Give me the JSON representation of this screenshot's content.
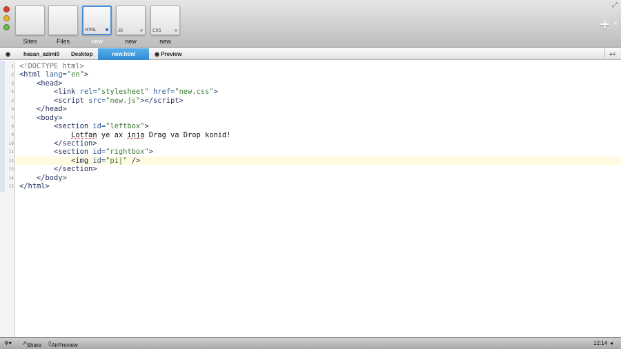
{
  "toolbar": {
    "tiles": [
      {
        "name": "Sites"
      },
      {
        "name": "Files"
      },
      {
        "name": "new",
        "badge": "HTML",
        "selected": true
      },
      {
        "name": "new",
        "badge": "JS"
      },
      {
        "name": "new",
        "badge": "CSS"
      }
    ],
    "add_label": "+"
  },
  "breadcrumb": {
    "items": [
      "hasan_azimi0",
      "Desktop",
      "new.html"
    ],
    "preview": "Preview"
  },
  "editor": {
    "line_numbers": [
      "1",
      "2",
      "3",
      "4",
      "5",
      "6",
      "7",
      "8",
      "9",
      "10",
      "11",
      "12",
      "13",
      "14",
      "15"
    ],
    "current_line": 12
  },
  "statusbar": {
    "share": "Share",
    "airpreview": "AirPreview",
    "time": "12:14"
  },
  "colors": {
    "tag": "#1f2a5c",
    "attribute": "#2f5d93",
    "string": "#3d7a35",
    "active_tab": "#3a94da"
  }
}
